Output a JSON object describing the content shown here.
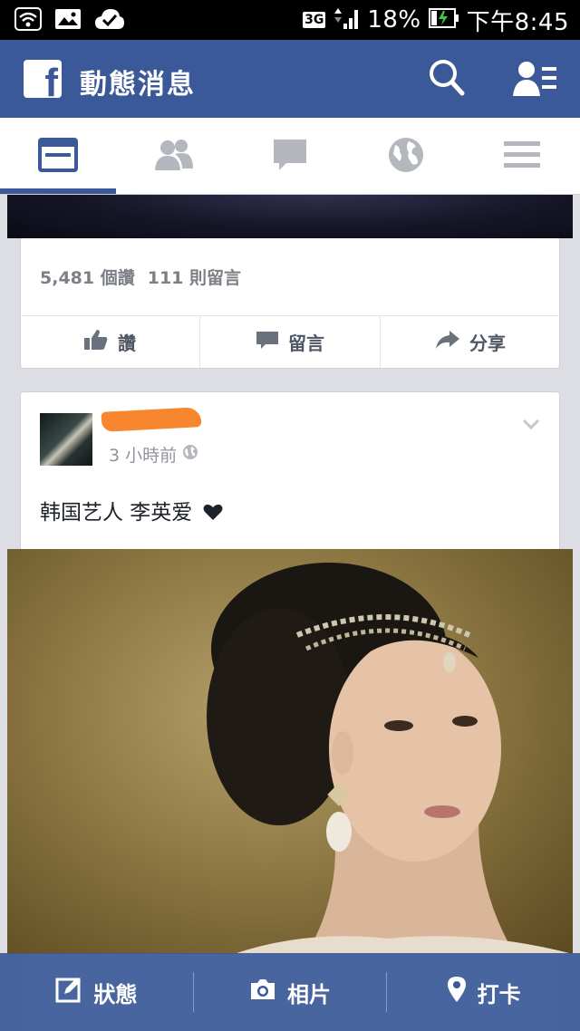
{
  "status_bar": {
    "network": "3G",
    "battery": "18%",
    "time": "下午8:45"
  },
  "header": {
    "logo": "f",
    "title": "動態消息"
  },
  "tabs": [
    {
      "icon": "news-feed-icon",
      "active": true
    },
    {
      "icon": "friends-icon",
      "active": false
    },
    {
      "icon": "messages-icon",
      "active": false
    },
    {
      "icon": "globe-icon",
      "active": false
    },
    {
      "icon": "menu-icon",
      "active": false
    }
  ],
  "previous_post": {
    "likes": "5,481 個讚",
    "comments": "111 則留言",
    "actions": {
      "like": "讚",
      "comment": "留言",
      "share": "分享"
    }
  },
  "post": {
    "time": "3 小時前",
    "text": "韩国艺人 李英爱"
  },
  "composer": {
    "status": "狀態",
    "photo": "相片",
    "checkin": "打卡"
  },
  "colors": {
    "brand": "#3b5998",
    "redaction": "#f7862f"
  }
}
